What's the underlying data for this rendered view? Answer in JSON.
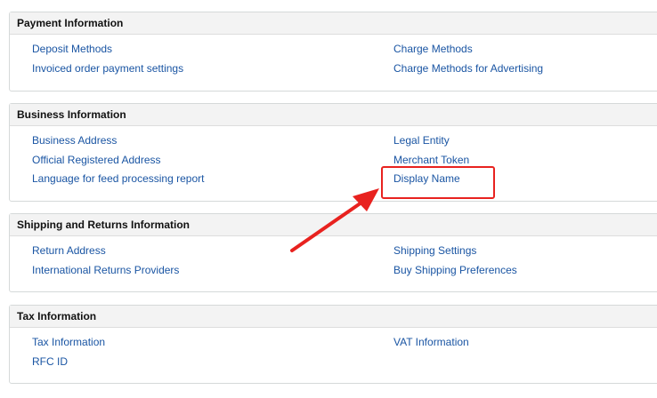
{
  "sections": {
    "payment": {
      "title": "Payment Information",
      "left": [
        "Deposit Methods",
        "Invoiced order payment settings"
      ],
      "right": [
        "Charge Methods",
        "Charge Methods for Advertising"
      ]
    },
    "business": {
      "title": "Business Information",
      "left": [
        "Business Address",
        "Official Registered Address",
        "Language for feed processing report"
      ],
      "right": [
        "Legal Entity",
        "Merchant Token",
        "Display Name"
      ]
    },
    "shipping": {
      "title": "Shipping and Returns Information",
      "left": [
        "Return Address",
        "International Returns Providers"
      ],
      "right": [
        "Shipping Settings",
        "Buy Shipping Preferences"
      ]
    },
    "tax": {
      "title": "Tax Information",
      "left": [
        "Tax Information",
        "RFC ID"
      ],
      "right": [
        "VAT Information"
      ]
    }
  },
  "colors": {
    "link": "#1a55a3",
    "header_bg": "#f3f3f3",
    "annotation": "#e8221f"
  }
}
